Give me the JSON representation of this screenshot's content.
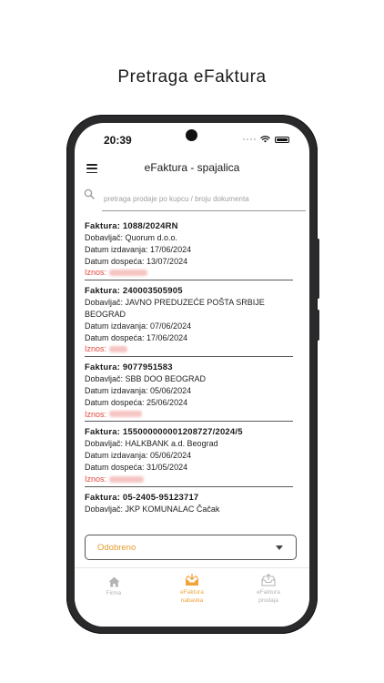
{
  "promo_title": "Pretraga eFaktura",
  "status_bar": {
    "time": "20:39"
  },
  "header": {
    "title": "eFaktura - spajalica"
  },
  "search": {
    "placeholder": "pretraga prodaje po kupcu / broju dokumenta"
  },
  "invoices": [
    {
      "title": "Faktura: 1088/2024RN",
      "supplier": "Dobavljač: Quorum d.o.o.",
      "issue_date": "Datum izdavanja: 17/06/2024",
      "due_date": "Datum dospeća: 13/07/2024",
      "amount_label": "Iznos:"
    },
    {
      "title": "Faktura: 240003505905",
      "supplier": "Dobavljač: JAVNO PREDUZEĆE POŠTA SRBIJE BEOGRAD",
      "issue_date": "Datum izdavanja: 07/06/2024",
      "due_date": "Datum dospeća: 17/06/2024",
      "amount_label": "Iznos:"
    },
    {
      "title": "Faktura: 9077951583",
      "supplier": "Dobavljač: SBB DOO BEOGRAD",
      "issue_date": "Datum izdavanja: 05/06/2024",
      "due_date": "Datum dospeća: 25/06/2024",
      "amount_label": "Iznos:"
    },
    {
      "title": "Faktura: 155000000001208727/2024/5",
      "supplier": "Dobavljač: HALKBANK a.d. Beograd",
      "issue_date": "Datum izdavanja: 05/06/2024",
      "due_date": "Datum dospeća: 31/05/2024",
      "amount_label": "Iznos:"
    },
    {
      "title": "Faktura: 05-2405-95123717",
      "supplier": "Dobavljač: JKP KOMUNALAC Čačak",
      "issue_date": "",
      "due_date": "",
      "amount_label": ""
    }
  ],
  "status_filter": {
    "selected": "Odobreno"
  },
  "bottom_nav": {
    "firma": "Firma",
    "nabavka_line1": "eFaktura",
    "nabavka_line2": "nabavka",
    "prodaja_line1": "eFaktura",
    "prodaja_line2": "prodaja"
  },
  "colors": {
    "accent": "#f0a43a",
    "amount_text": "#e2463d",
    "inactive_nav": "#b4b4b4"
  }
}
